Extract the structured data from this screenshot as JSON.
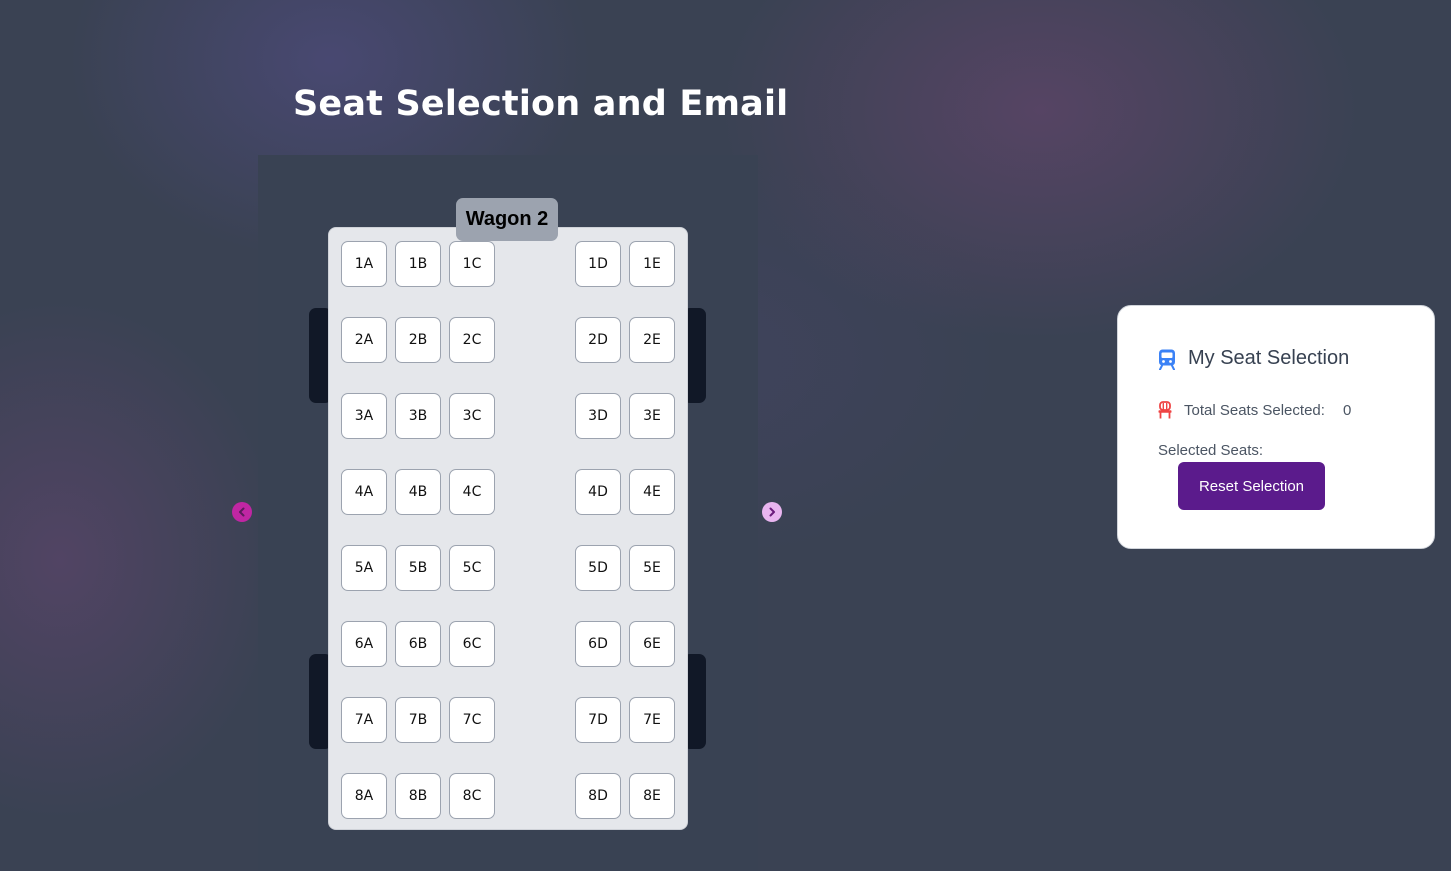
{
  "page": {
    "title": "Seat Selection and Email"
  },
  "wagon": {
    "label": "Wagon 2"
  },
  "seats": {
    "r1": [
      "1A",
      "1B",
      "1C",
      "1D",
      "1E"
    ],
    "r2": [
      "2A",
      "2B",
      "2C",
      "2D",
      "2E"
    ],
    "r3": [
      "3A",
      "3B",
      "3C",
      "3D",
      "3E"
    ],
    "r4": [
      "4A",
      "4B",
      "4C",
      "4D",
      "4E"
    ],
    "r5": [
      "5A",
      "5B",
      "5C",
      "5D",
      "5E"
    ],
    "r6": [
      "6A",
      "6B",
      "6C",
      "6D",
      "6E"
    ],
    "r7": [
      "7A",
      "7B",
      "7C",
      "7D",
      "7E"
    ],
    "r8": [
      "8A",
      "8B",
      "8C",
      "8D",
      "8E"
    ]
  },
  "nav": {
    "prev_icon": "chevron-left-icon",
    "next_icon": "chevron-right-icon"
  },
  "panel": {
    "title": "My Seat Selection",
    "title_icon": "train-icon",
    "total_icon": "seat-icon",
    "total_label": "Total Seats Selected:",
    "total_value": "0",
    "selected_label": "Selected Seats:",
    "reset_label": "Reset Selection"
  },
  "colors": {
    "background": "#3a4253",
    "wagon_body": "#e5e7eb",
    "wagon_label_bg": "#9ca3af",
    "door": "#111827",
    "reset_button": "#5b1b8c",
    "train_icon": "#3b82f6",
    "seat_icon": "#ef4444",
    "prev_arrow": "#c026a3",
    "next_arrow": "#e9b5f0"
  }
}
